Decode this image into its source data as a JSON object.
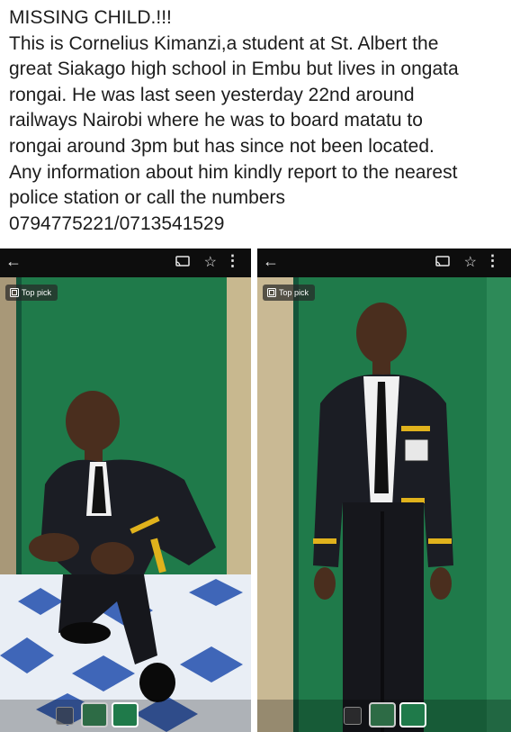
{
  "post": {
    "lines": [
      "MISSING CHILD.!!!",
      "This is Cornelius Kimanzi,a student at  St. Albert the",
      "great Siakago high school in Embu but lives in ongata",
      "rongai. He was last seen yesterday 22nd around",
      "railways Nairobi where he was to board matatu to",
      "rongai around 3pm but has since not been located.",
      "Any information about him kindly report to the nearest",
      "police station or call the numbers",
      "0794775221/0713541529"
    ]
  },
  "screenshots": [
    {
      "back_icon": "back-arrow-icon",
      "cast_icon": "cast-icon",
      "star_icon": "star-icon",
      "more_icon": "more-vertical-icon",
      "badge_label": "Top pick",
      "photo_desc_icon": "photo-crouching-boy"
    },
    {
      "back_icon": "back-arrow-icon",
      "cast_icon": "cast-icon",
      "star_icon": "star-icon",
      "more_icon": "more-vertical-icon",
      "badge_label": "Top pick",
      "photo_desc_icon": "photo-standing-boy"
    }
  ],
  "colors": {
    "wall_green": "#1f7a4a",
    "blazer": "#1b1d24",
    "gold_trim": "#e0b21c",
    "floor_blue": "#3f66b8"
  }
}
